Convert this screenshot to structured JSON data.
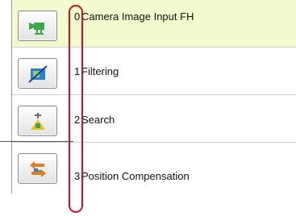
{
  "flow": {
    "items": [
      {
        "number": "0",
        "label": "Camera Image Input FH",
        "icon": "camera-icon",
        "selected": true
      },
      {
        "number": "1",
        "label": "Filtering",
        "icon": "filter-icon",
        "selected": false
      },
      {
        "number": "2",
        "label": "Search",
        "icon": "search-marker-icon",
        "selected": false
      },
      {
        "number": "3",
        "label": "Position Compensation",
        "icon": "position-compensation-icon",
        "selected": false
      }
    ]
  },
  "colors": {
    "selected_row": "#f5f9ce",
    "callout": "#c8102e",
    "icon_green": "#3aa84a",
    "icon_blue": "#2f7fd1",
    "icon_orange": "#e77a1e"
  }
}
